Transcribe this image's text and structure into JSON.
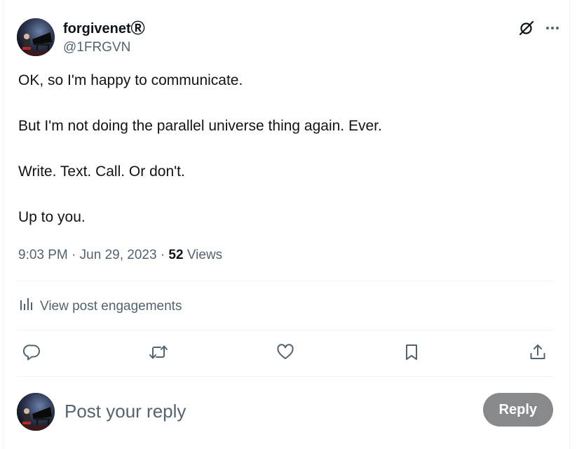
{
  "author": {
    "display_name": "forgivenetⓇ",
    "handle": "@1FRGVN"
  },
  "tweet": {
    "paragraphs": [
      "OK, so I'm happy to communicate.",
      "But I'm not doing the parallel universe thing again. Ever.",
      "Write. Text. Call. Or don't.",
      "Up to you."
    ]
  },
  "meta": {
    "time": "9:03 PM",
    "separator": "·",
    "date": "Jun 29, 2023",
    "views_count": "52",
    "views_label": "Views"
  },
  "engagements": {
    "label": "View post engagements"
  },
  "actions": {
    "icons": [
      "reply-icon",
      "repost-icon",
      "like-icon",
      "bookmark-icon",
      "share-icon"
    ]
  },
  "composer": {
    "placeholder": "Post your reply",
    "button_label": "Reply"
  },
  "colors": {
    "text_primary": "#0f1419",
    "text_secondary": "#536471",
    "divider": "#eff3f4",
    "reply_button_disabled": "#87898c"
  }
}
